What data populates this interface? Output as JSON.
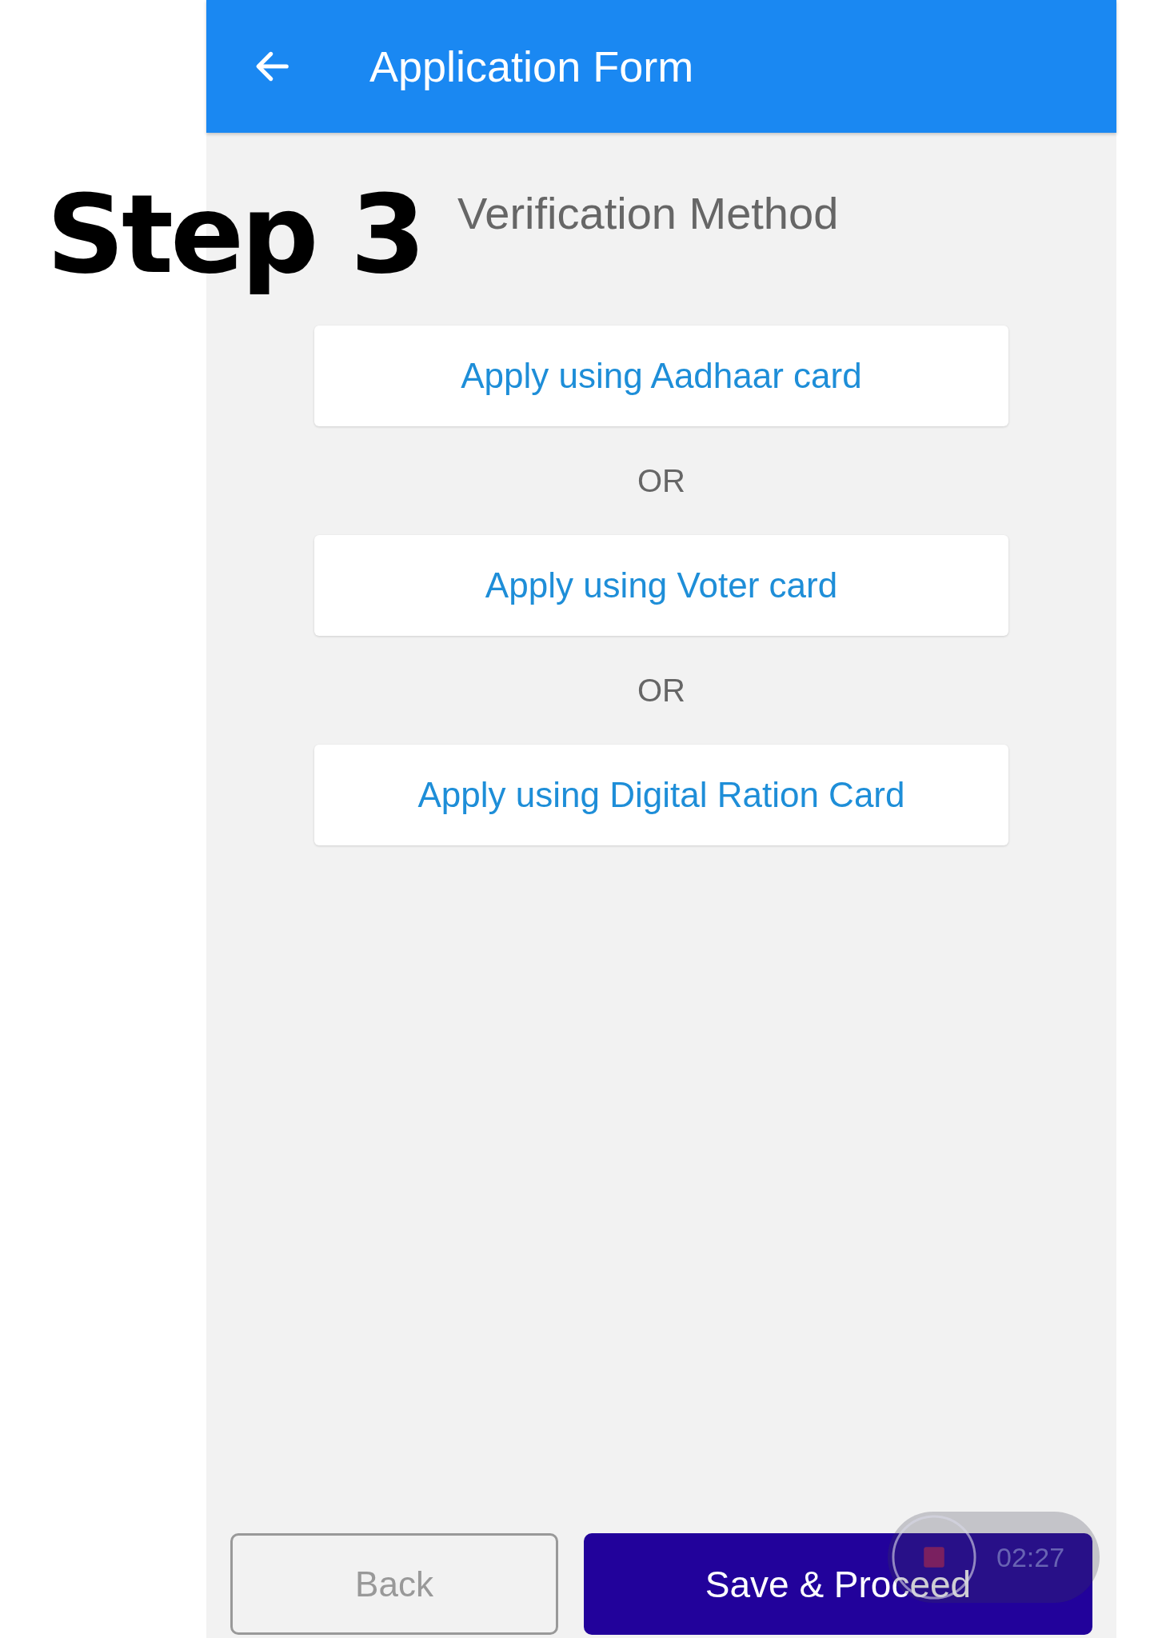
{
  "caption": "Step 3",
  "app_bar": {
    "title": "Application Form"
  },
  "section_title": "Verification Method",
  "options": [
    {
      "kind": "option",
      "label": "Apply using Aadhaar card"
    },
    {
      "kind": "separator",
      "label": "OR"
    },
    {
      "kind": "option",
      "label": "Apply using Voter card"
    },
    {
      "kind": "separator",
      "label": "OR"
    },
    {
      "kind": "option",
      "label": "Apply using Digital Ration Card"
    }
  ],
  "footer": {
    "back": "Back",
    "proceed": "Save & Proceed"
  },
  "recorder": {
    "time": "02:27"
  }
}
